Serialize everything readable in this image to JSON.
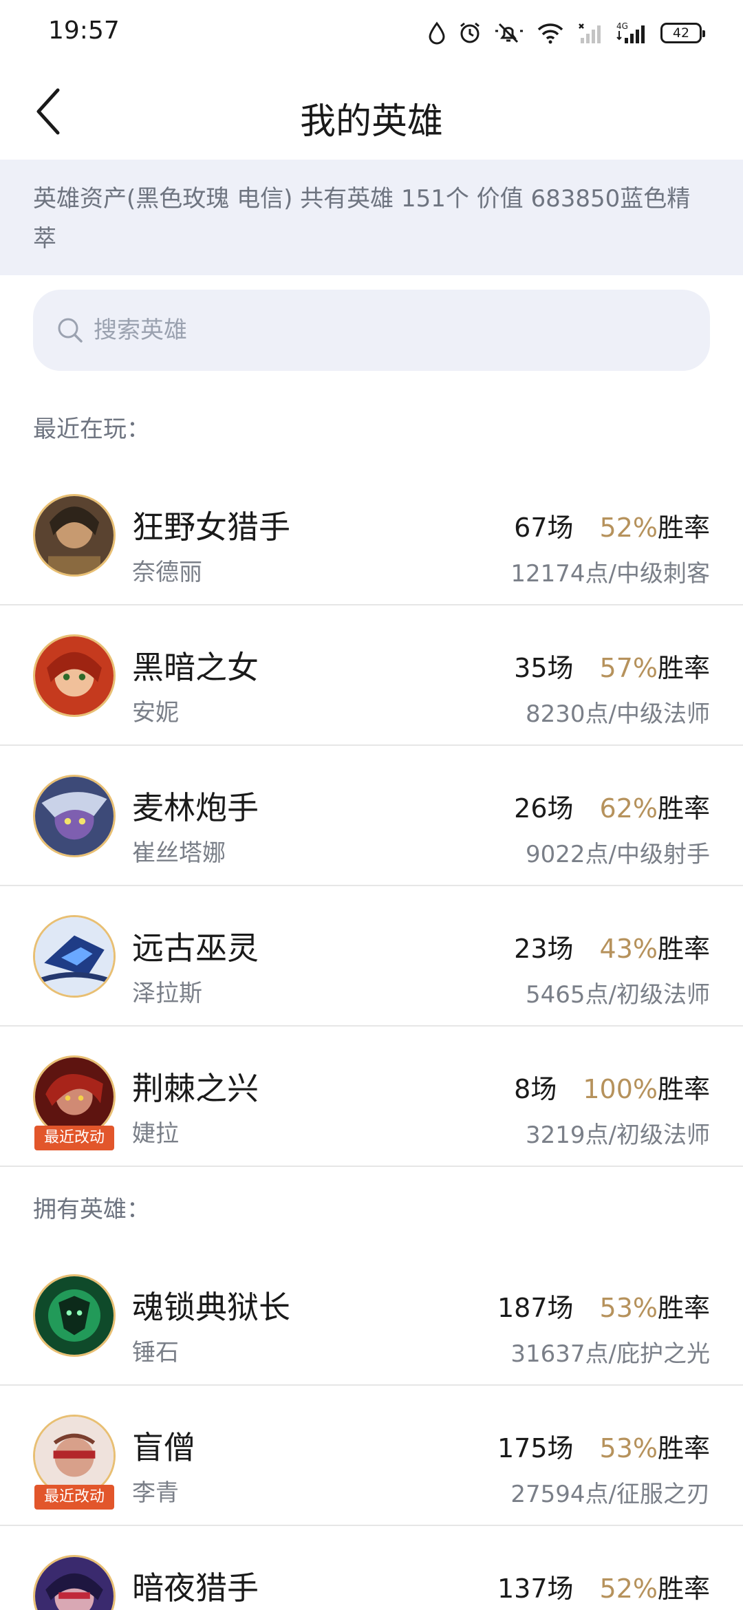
{
  "status_bar": {
    "time": "19:57",
    "battery": "42",
    "icons": [
      "drop-icon",
      "alarm-icon",
      "mute-icon",
      "wifi-icon",
      "signal-off-icon",
      "signal-4g-icon",
      "battery-icon"
    ]
  },
  "header": {
    "title": "我的英雄",
    "back_icon": "chevron-left-icon"
  },
  "asset_banner": {
    "text": "英雄资产(黑色玫瑰 电信) 共有英雄 151个 价值 683850蓝色精萃"
  },
  "search": {
    "placeholder": "搜索英雄",
    "icon": "search-icon"
  },
  "sections": {
    "recent_label": "最近在玩：",
    "owned_label": "拥有英雄："
  },
  "recent_heroes": [
    {
      "name": "狂野女猎手",
      "alias": "奈德丽",
      "games": "67场",
      "rate": "52%",
      "rate_suffix": "胜率",
      "points": "12174点/中级刺客"
    },
    {
      "name": "黑暗之女",
      "alias": "安妮",
      "games": "35场",
      "rate": "57%",
      "rate_suffix": "胜率",
      "points": "8230点/中级法师"
    },
    {
      "name": "麦林炮手",
      "alias": "崔丝塔娜",
      "games": "26场",
      "rate": "62%",
      "rate_suffix": "胜率",
      "points": "9022点/中级射手"
    },
    {
      "name": "远古巫灵",
      "alias": "泽拉斯",
      "games": "23场",
      "rate": "43%",
      "rate_suffix": "胜率",
      "points": "5465点/初级法师"
    },
    {
      "name": "荆棘之兴",
      "alias": "婕拉",
      "games": "8场",
      "rate": "100%",
      "rate_suffix": "胜率",
      "points": "3219点/初级法师",
      "badge": "最近改动"
    }
  ],
  "owned_heroes": [
    {
      "name": "魂锁典狱长",
      "alias": "锤石",
      "games": "187场",
      "rate": "53%",
      "rate_suffix": "胜率",
      "points": "31637点/庇护之光"
    },
    {
      "name": "盲僧",
      "alias": "李青",
      "games": "175场",
      "rate": "53%",
      "rate_suffix": "胜率",
      "points": "27594点/征服之刃",
      "badge": "最近改动"
    },
    {
      "name": "暗夜猎手",
      "games": "137场",
      "rate": "52%",
      "rate_suffix": "胜率"
    }
  ],
  "colors": {
    "accent_gold": "#b6925c",
    "badge_red": "#e2562b",
    "banner_bg": "#eef0f8",
    "avatar_ring": "#e8bf73"
  }
}
